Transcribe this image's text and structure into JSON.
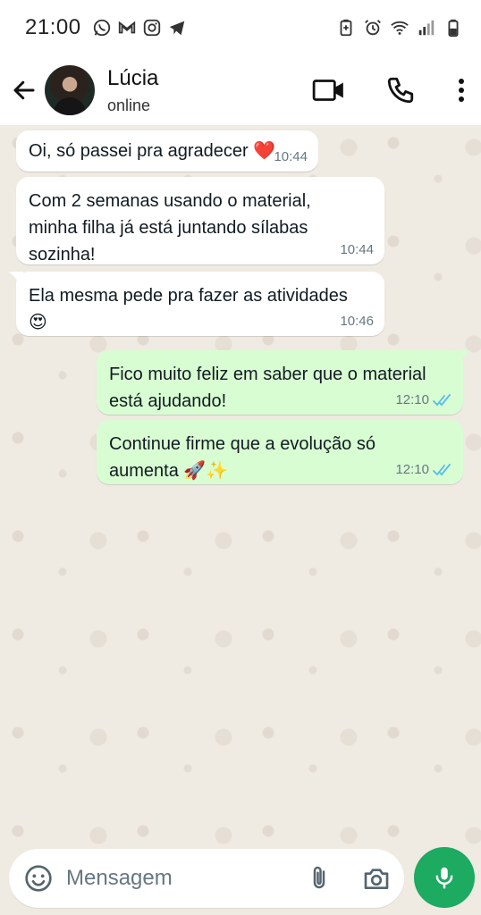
{
  "status_bar": {
    "time": "21:00",
    "left_icons": [
      "whatsapp-icon",
      "gmail-icon",
      "instagram-icon",
      "telegram-icon"
    ],
    "right_icons": [
      "battery-saver-icon",
      "alarm-icon",
      "wifi-icon",
      "signal-icon",
      "battery-icon"
    ]
  },
  "header": {
    "contact_name": "Lúcia",
    "contact_status": "online",
    "actions": [
      "video-call-icon",
      "voice-call-icon",
      "more-options-icon"
    ]
  },
  "messages": [
    {
      "direction": "in",
      "text": "Oi, só passei pra agradecer ❤️",
      "time": "10:44"
    },
    {
      "direction": "in",
      "text": "Com 2 semanas usando o material, minha filha já está juntando sílabas sozinha!",
      "time": "10:44"
    },
    {
      "direction": "in",
      "text": "Ela mesma pede pra fazer as atividades 😍",
      "time": "10:46"
    },
    {
      "direction": "out",
      "text": "Fico muito feliz em saber que o material está ajudando!",
      "time": "12:10",
      "status": "read"
    },
    {
      "direction": "out",
      "text": "Continue firme que a evolução só aumenta 🚀✨",
      "time": "12:10",
      "status": "read"
    }
  ],
  "input": {
    "placeholder": "Mensagem",
    "value": ""
  },
  "colors": {
    "outgoing_bubble": "#d9fdd3",
    "incoming_bubble": "#ffffff",
    "chat_background": "#efeae2",
    "mic_button": "#1daa61",
    "read_ticks": "#53bdeb"
  }
}
